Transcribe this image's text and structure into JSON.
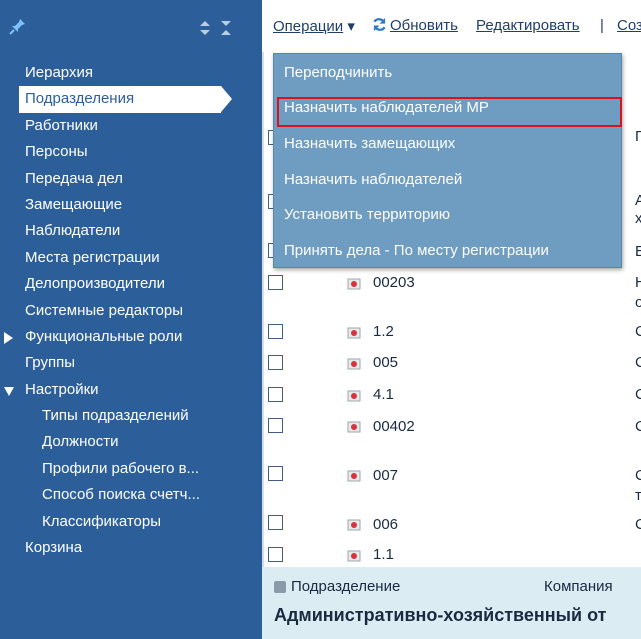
{
  "sidebar": {
    "items": [
      {
        "label": "Иерархия"
      },
      {
        "label": "Подразделения"
      },
      {
        "label": "Работники"
      },
      {
        "label": "Персоны"
      },
      {
        "label": "Передача дел"
      },
      {
        "label": "Замещающие"
      },
      {
        "label": "Наблюдатели"
      },
      {
        "label": "Места регистрации"
      },
      {
        "label": "Делопроизводители"
      },
      {
        "label": "Системные редакторы"
      },
      {
        "label": "Функциональные роли"
      },
      {
        "label": "Группы"
      },
      {
        "label": "Настройки"
      },
      {
        "label": "Типы подразделений"
      },
      {
        "label": "Должности"
      },
      {
        "label": "Профили рабочего в..."
      },
      {
        "label": "Способ поиска счетч..."
      },
      {
        "label": "Классификаторы"
      },
      {
        "label": "Корзина"
      }
    ]
  },
  "toolbar": {
    "operations": "Операции",
    "arrow": "▾",
    "refresh": "Обновить",
    "edit": "Редактировать",
    "separator": "|",
    "create": "Соз"
  },
  "menu": {
    "items": [
      {
        "label": "Переподчинить"
      },
      {
        "label": "Назначить наблюдателей МР"
      },
      {
        "label": "Назначить замещающих"
      },
      {
        "label": "Назначить наблюдателей"
      },
      {
        "label": "Установить территорию"
      },
      {
        "label": "Принять дела - По месту регистрации"
      }
    ]
  },
  "content": {
    "header_fragments": {
      "top_right": "П",
      "row1_right": "А",
      "row1_right2": "х",
      "row2_right": "Б"
    },
    "rows": [
      {
        "code": "00203",
        "tail": "Н",
        "tail2": "о"
      },
      {
        "code": "1.2",
        "tail": "С"
      },
      {
        "code": "005",
        "tail": "С"
      },
      {
        "code": "4.1",
        "tail": "С"
      },
      {
        "code": "00402",
        "tail": "С"
      },
      {
        "code": "007",
        "tail": "С",
        "tail2": "т"
      },
      {
        "code": "006",
        "tail": "С"
      },
      {
        "code": "1.1",
        "tail": ""
      }
    ]
  },
  "bottom": {
    "type_label": "Подразделение",
    "company_label": "Компания",
    "title": "Административно-хозяйственный от"
  },
  "colors": {
    "sidebar": "#2c5f9a",
    "menu": "#6f9cc1",
    "highlight": "#d9121f",
    "bottom": "#dcecf3"
  }
}
